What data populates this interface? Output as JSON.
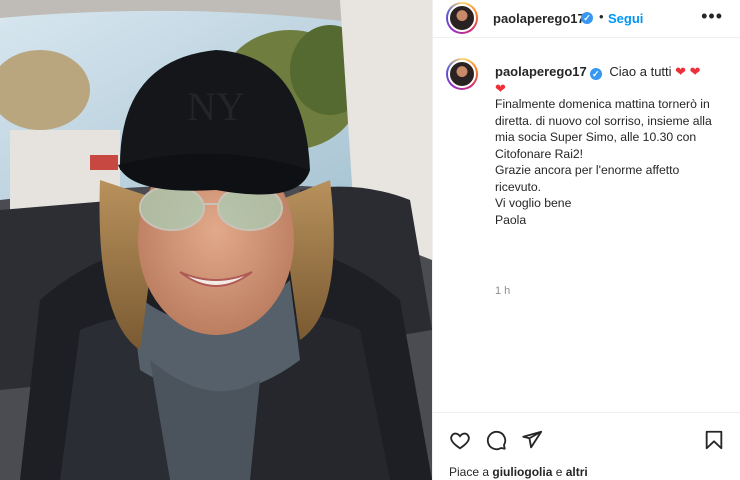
{
  "post": {
    "username": "paolaperego17",
    "follow_label": "Segui",
    "more_label": "•••",
    "separator": "•"
  },
  "caption": {
    "username": "paolaperego17",
    "greeting": "Ciao a tutti",
    "hearts": "❤ ❤",
    "extra_heart": "❤",
    "lines": [
      "Finalmente domenica mattina tornerò in diretta. di nuovo col sorriso, insieme alla mia socia Super Simo, alle 10.30 con Citofonare Rai2!",
      "Grazie ancora per l'enorme affetto ricevuto.",
      "Vi voglio bene",
      "Paola"
    ],
    "time": "1 h"
  },
  "footer": {
    "likes_prefix": "Piace a",
    "liked_by": "giuliogolia",
    "likes_mid": "e",
    "likes_others": "altri"
  },
  "icons": {
    "verified": "verified-badge-icon",
    "like": "heart-outline-icon",
    "comment": "comment-bubble-icon",
    "share": "paper-plane-icon",
    "save": "bookmark-icon"
  },
  "colors": {
    "follow": "#0095f6",
    "verified": "#3897f0",
    "heart": "#ed2f3a",
    "muted": "#8e8e8e"
  }
}
